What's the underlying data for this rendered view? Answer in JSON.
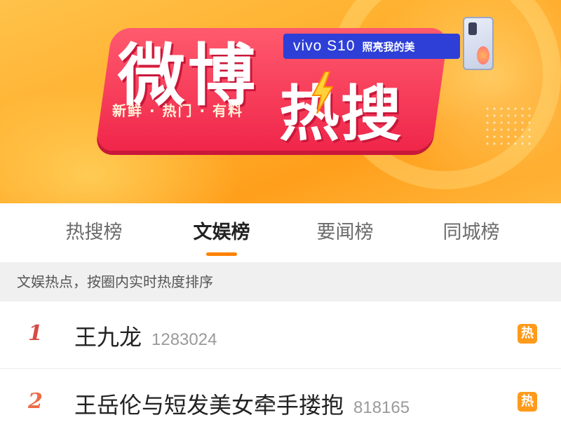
{
  "banner": {
    "logo_line1": "微博",
    "logo_line2": "热搜",
    "tagline": "新鲜 · 热门 · 有料",
    "sponsor_brand": "vivo S10",
    "sponsor_slogan": "照亮我的美",
    "accent_color": "#f0264a",
    "background_color": "#ffb02e"
  },
  "tabs": [
    {
      "label": "热搜榜",
      "active": false
    },
    {
      "label": "文娱榜",
      "active": true
    },
    {
      "label": "要闻榜",
      "active": false
    },
    {
      "label": "同城榜",
      "active": false
    }
  ],
  "subheader": "文娱热点，按圈内实时热度排序",
  "list": [
    {
      "rank": "1",
      "title": "王九龙",
      "count": "1283024",
      "badge": "热"
    },
    {
      "rank": "2",
      "title": "王岳伦与短发美女牵手搂抱",
      "count": "818165",
      "badge": "热"
    }
  ],
  "colors": {
    "tab_indicator": "#ff8200",
    "hot_badge": "#ff9a1a"
  }
}
